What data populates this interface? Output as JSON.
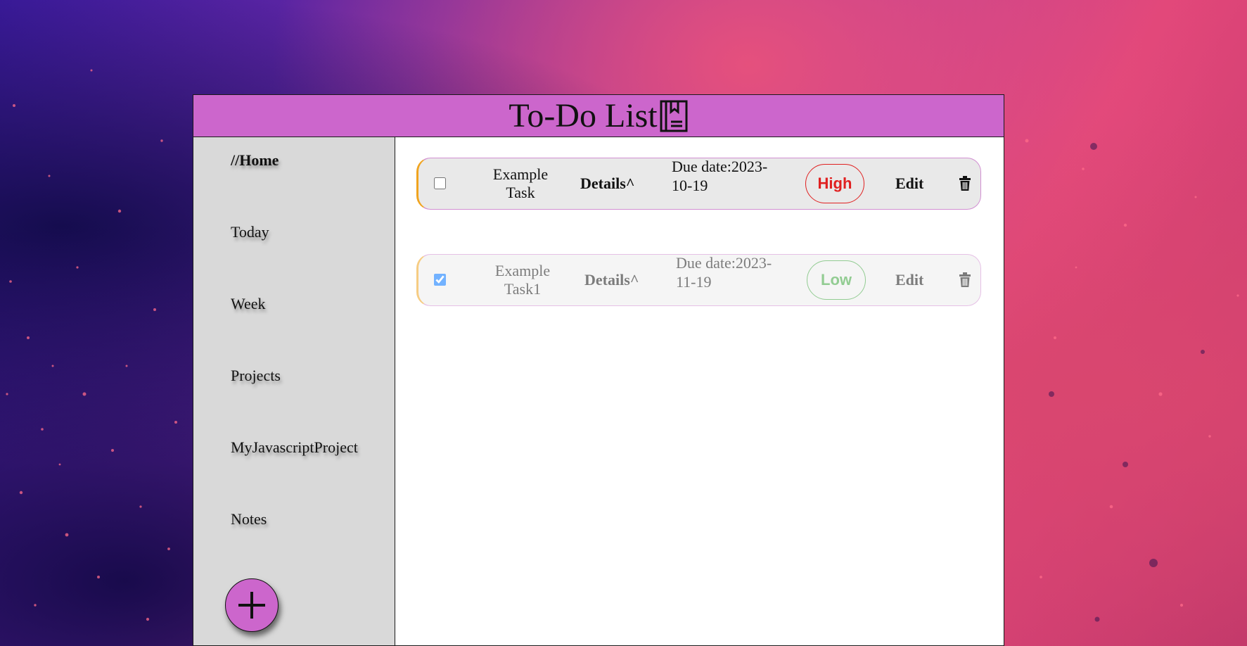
{
  "app": {
    "title": "To-Do List",
    "title_icon": "bookmark-book-icon",
    "accent_color": "#cc66cc"
  },
  "sidebar": {
    "items": [
      {
        "label": "//Home",
        "active": true
      },
      {
        "label": "Today"
      },
      {
        "label": "Week"
      },
      {
        "label": "Projects"
      },
      {
        "label": "MyJavascriptProject"
      },
      {
        "label": "Notes"
      }
    ],
    "add_button_icon": "plus-icon"
  },
  "tasks": [
    {
      "name": "Example Task",
      "details_label": "Details^",
      "due": "Due date:2023-10-19",
      "priority": "High",
      "priority_color": "#e02020",
      "edit_label": "Edit",
      "delete_icon": "trash-icon",
      "completed": false
    },
    {
      "name": "Example Task1",
      "details_label": "Details^",
      "due": "Due date:2023-11-19",
      "priority": "Low",
      "priority_color": "#3aa33a",
      "edit_label": "Edit",
      "delete_icon": "trash-icon",
      "completed": true
    }
  ]
}
